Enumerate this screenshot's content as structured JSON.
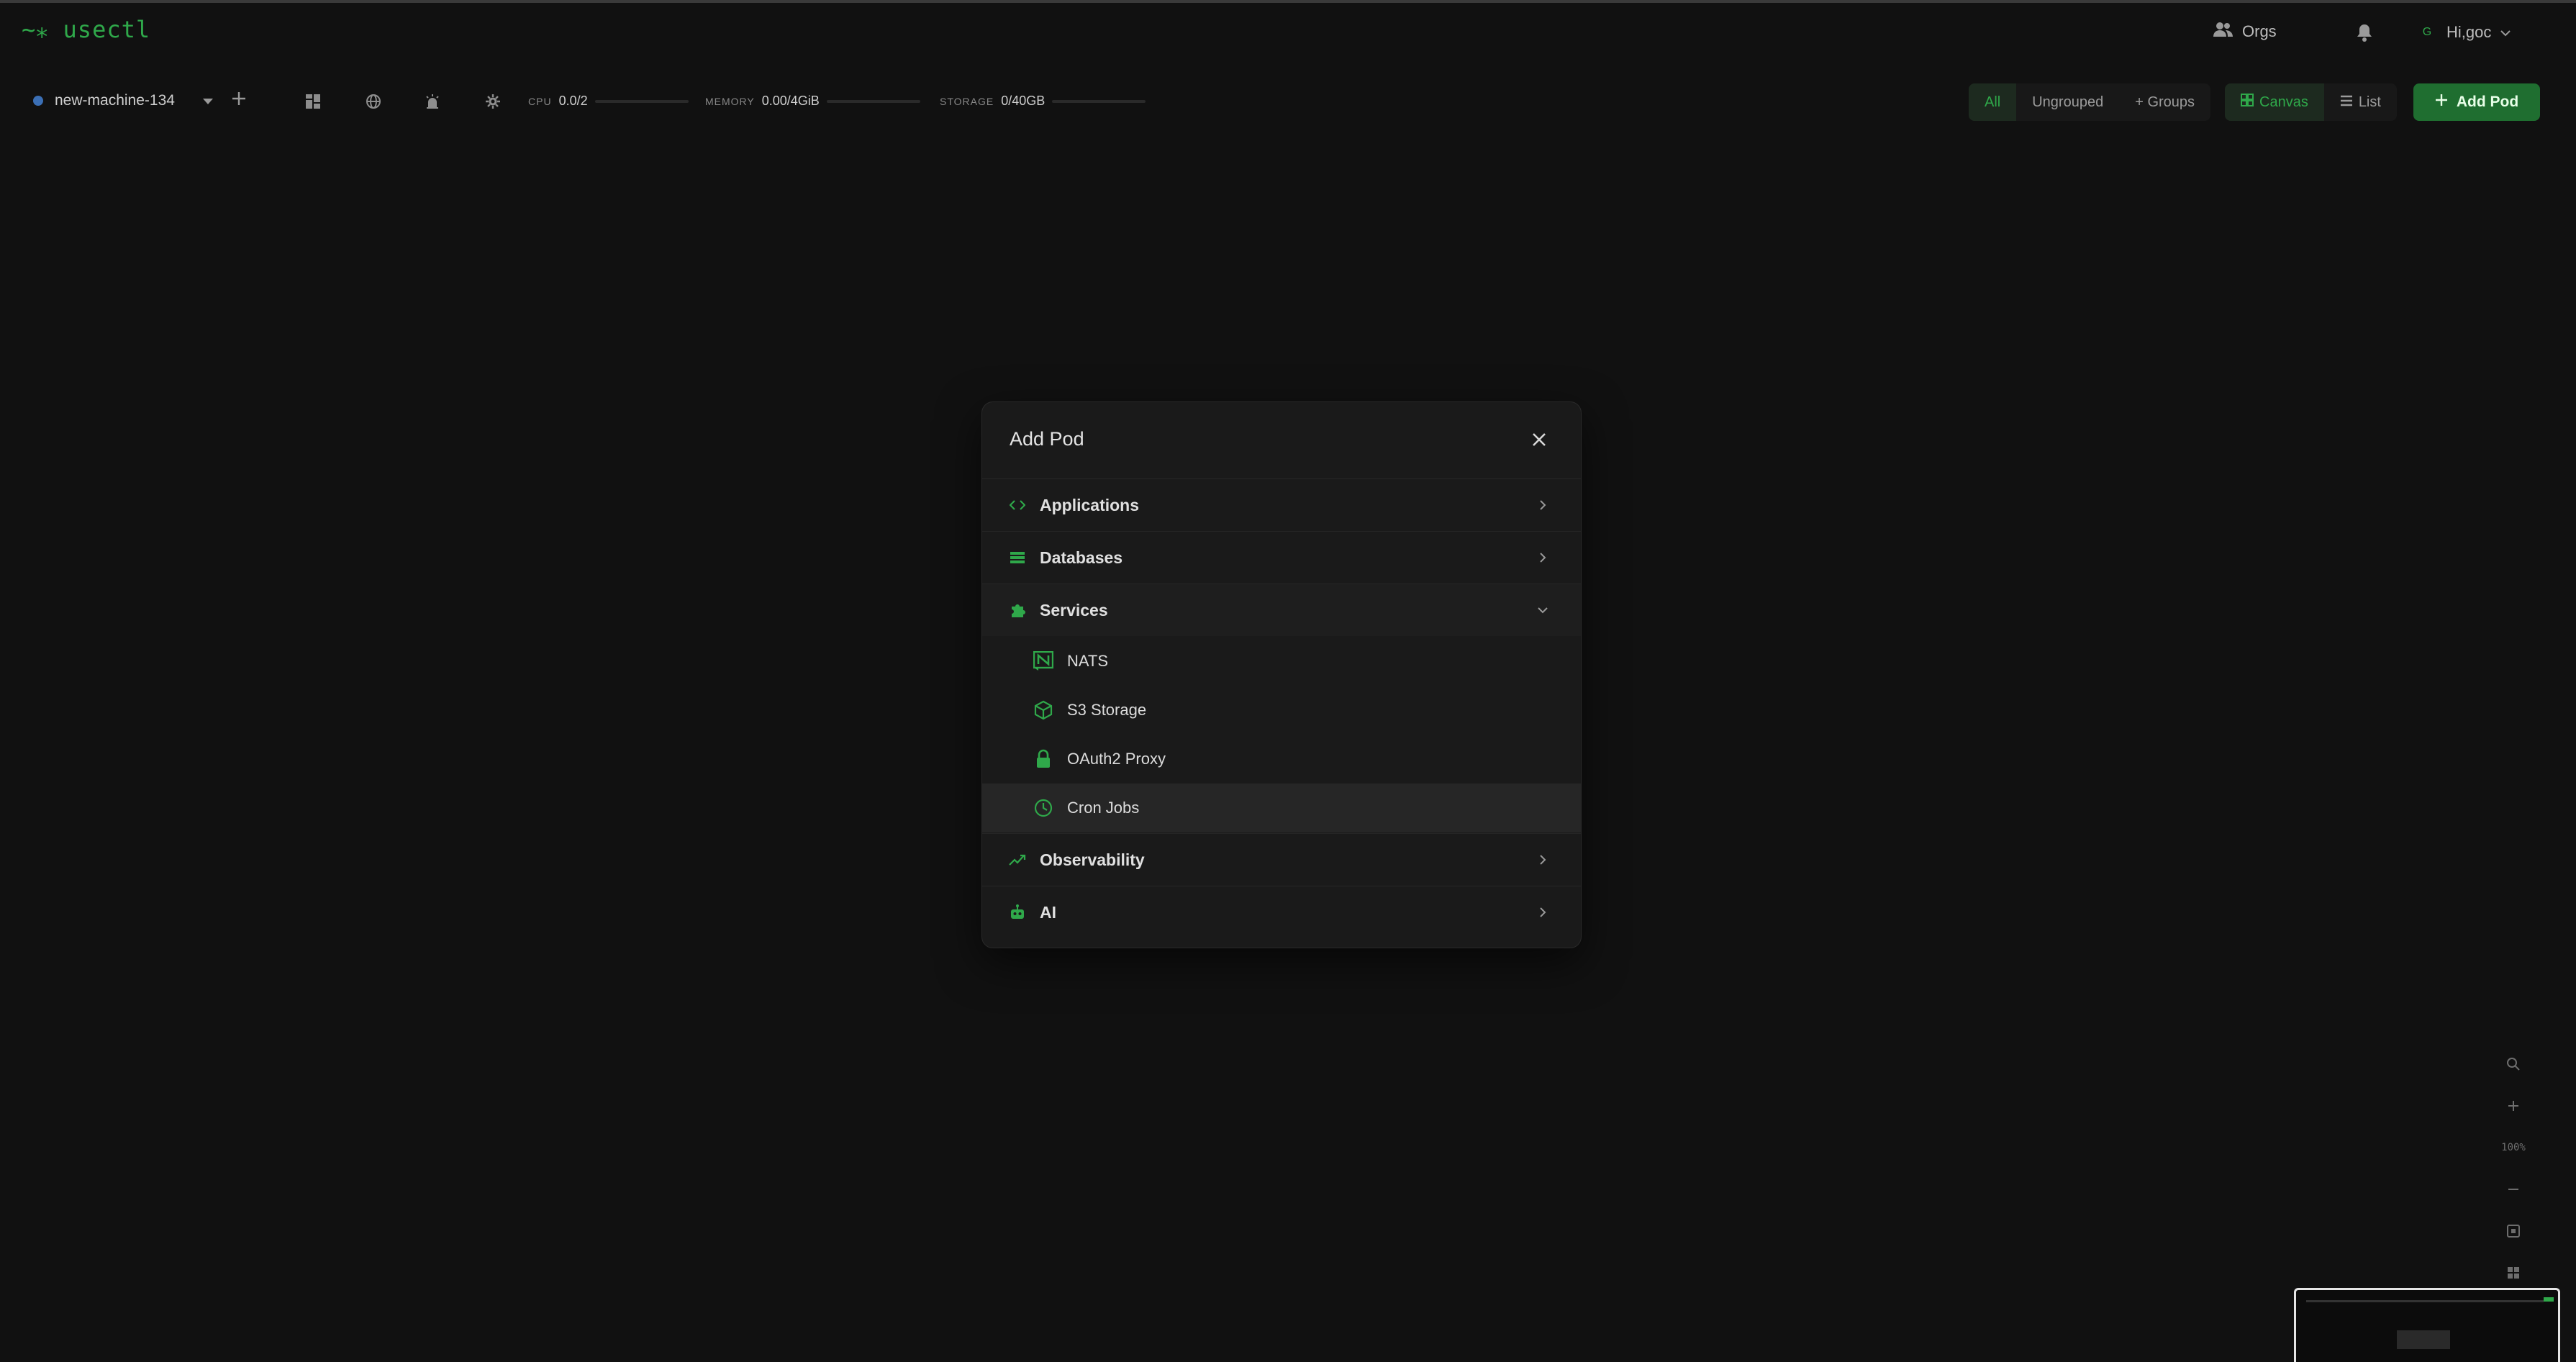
{
  "app": {
    "logo": "~⁎ usectl"
  },
  "header": {
    "orgs_label": "Orgs",
    "avatar_letter": "G",
    "user_greeting": "Hi,goc"
  },
  "toolbar": {
    "machine_name": "new-machine-134",
    "cpu": {
      "label": "CPU",
      "value": "0.0/2",
      "usage": 0.0
    },
    "memory": {
      "label": "MEMORY",
      "value": "0.00/4GiB",
      "usage": 0.0
    },
    "storage": {
      "label": "STORAGE",
      "value": "0/40GB",
      "usage": 0.0
    },
    "filters": {
      "all": "All",
      "ungrouped": "Ungrouped",
      "groups": "+ Groups"
    },
    "views": {
      "canvas": "Canvas",
      "list": "List"
    },
    "add_pod": "Add Pod"
  },
  "modal": {
    "title": "Add Pod",
    "categories": [
      {
        "label": "Applications",
        "icon": "code-icon",
        "expanded": false
      },
      {
        "label": "Databases",
        "icon": "database-icon",
        "expanded": false
      },
      {
        "label": "Services",
        "icon": "puzzle-icon",
        "expanded": true
      },
      {
        "label": "Observability",
        "icon": "trend-icon",
        "expanded": false
      },
      {
        "label": "AI",
        "icon": "robot-icon",
        "expanded": false
      }
    ],
    "services_items": [
      {
        "label": "NATS",
        "icon": "nats-icon"
      },
      {
        "label": "S3 Storage",
        "icon": "box-icon"
      },
      {
        "label": "OAuth2 Proxy",
        "icon": "lock-icon"
      },
      {
        "label": "Cron Jobs",
        "icon": "clock-icon",
        "highlighted": true
      }
    ]
  },
  "zoom": {
    "level": "100%"
  },
  "colors": {
    "accent": "#2fa84a",
    "background": "#111111",
    "modal_bg": "#1a1a1a",
    "button_bg": "#1f6e30"
  }
}
